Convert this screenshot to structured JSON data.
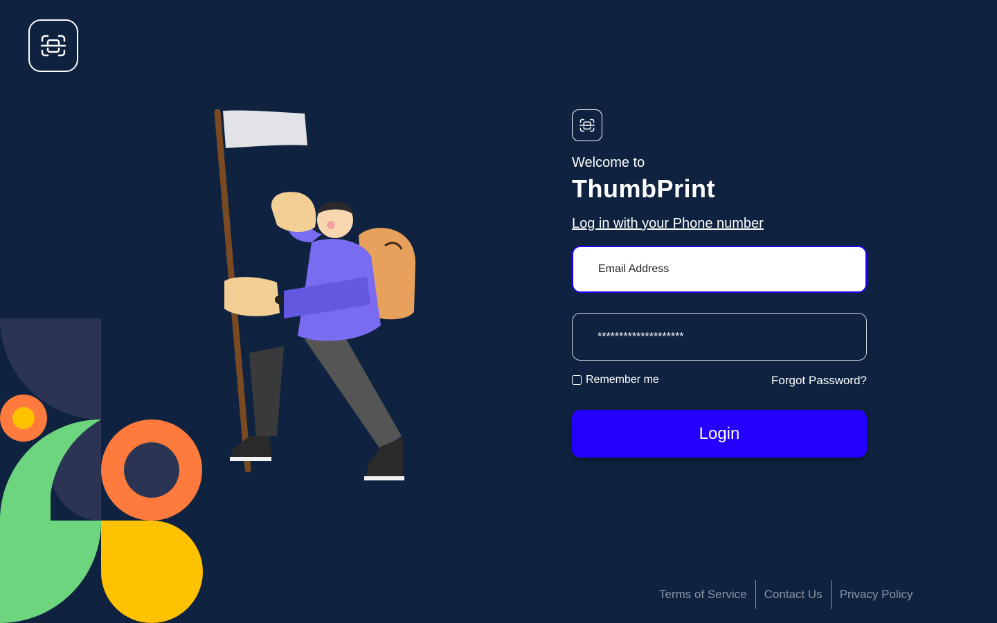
{
  "brand": {
    "welcome": "Welcome to",
    "name": "ThumbPrint",
    "logo_icon": "scan-icon"
  },
  "login": {
    "phone_link": "Log in with your Phone number",
    "email_placeholder": "Email Address",
    "password_value": "********************",
    "remember_label": "Remember me",
    "forgot_label": "Forgot Password?",
    "submit_label": "Login"
  },
  "footer": {
    "terms": "Terms of Service",
    "contact": "Contact Us",
    "privacy": "Privacy Policy"
  },
  "colors": {
    "background": "#0f2340",
    "accent": "#2400ff",
    "footer_text": "#8a94a6"
  }
}
